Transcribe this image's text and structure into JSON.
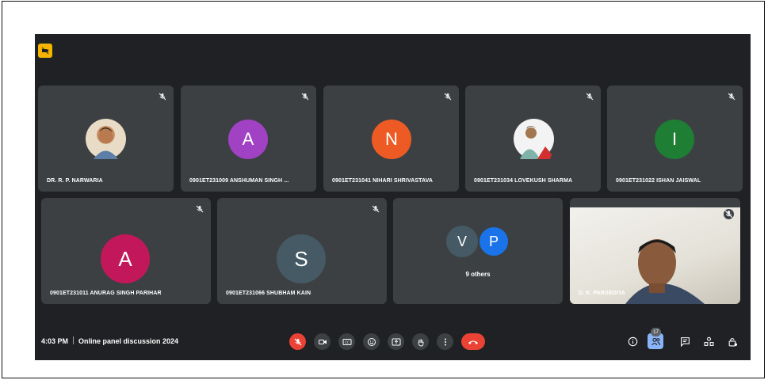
{
  "meeting": {
    "time": "4:03 PM",
    "title": "Online panel discussion 2024",
    "participant_count": "17"
  },
  "tiles": [
    {
      "name": "DR. R. P. NARWARIA",
      "type": "photo"
    },
    {
      "name": "0901ET231009 ANSHUMAN SINGH ...",
      "initial": "A",
      "color": "#a142c4"
    },
    {
      "name": "0901ET231041 NIHARI SHRIVASTAVA",
      "initial": "N",
      "color": "#ee5a24"
    },
    {
      "name": "0901ET231034 LOVEKUSH SHARMA",
      "type": "photo"
    },
    {
      "name": "0901ET231022 ISHAN JAISWAL",
      "initial": "I",
      "color": "#1e7e34"
    },
    {
      "name": "0901ET231011 ANURAG SINGH PARIHAR",
      "initial": "A",
      "color": "#c2185b"
    },
    {
      "name": "0901ET231066 SHUBHAM KAIN",
      "initial": "S",
      "color": "#455a64"
    },
    {
      "others_label": "9 others",
      "initials": [
        "V",
        "P"
      ]
    },
    {
      "name": "D. K. PARSEDIYA",
      "type": "video"
    }
  ],
  "colors": {
    "background": "#202124",
    "tile": "#3c4043",
    "danger": "#ea4335",
    "accent": "#8ab4f8"
  }
}
